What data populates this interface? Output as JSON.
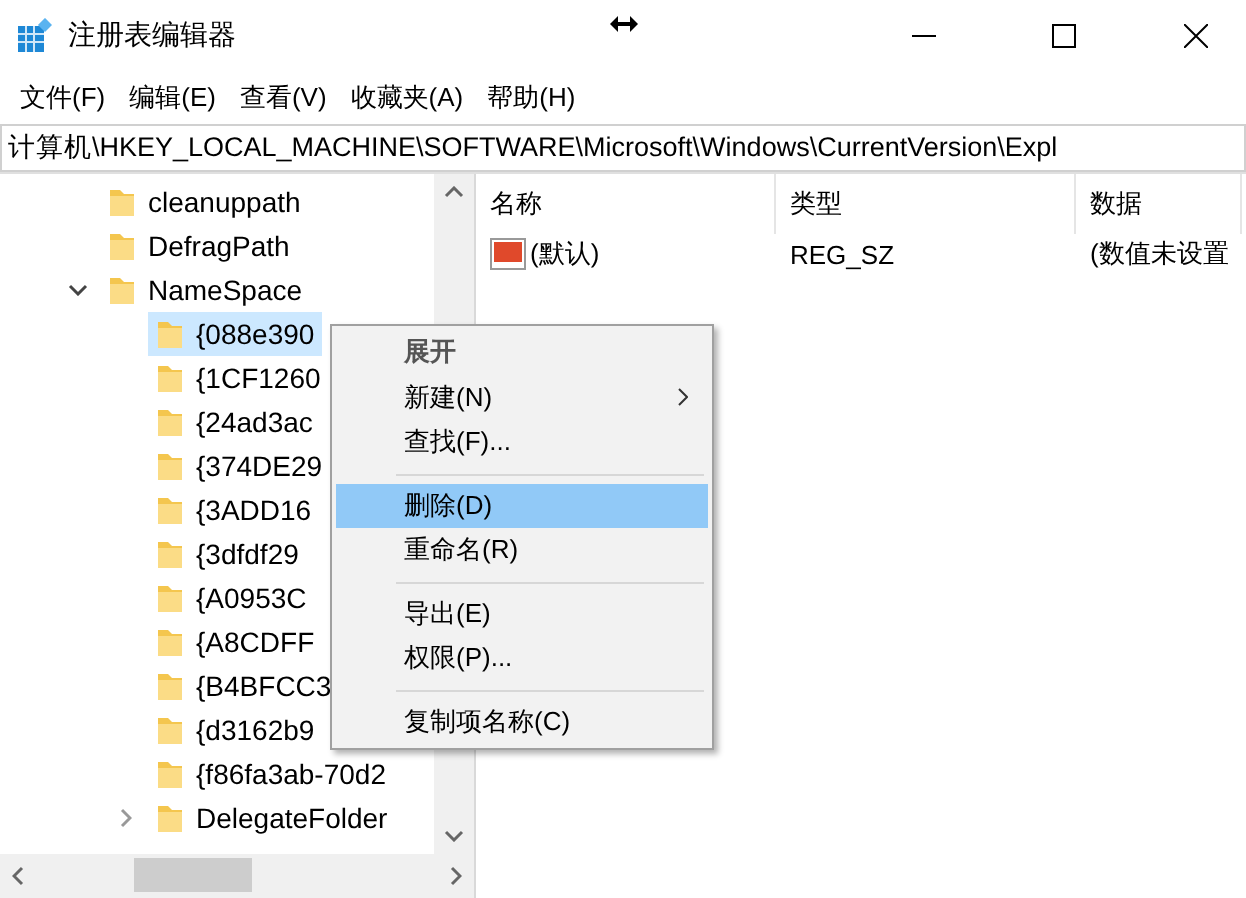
{
  "window": {
    "title": "注册表编辑器"
  },
  "menu_bar": [
    "文件(F)",
    "编辑(E)",
    "查看(V)",
    "收藏夹(A)",
    "帮助(H)"
  ],
  "address_bar": {
    "value": "计算机\\HKEY_LOCAL_MACHINE\\SOFTWARE\\Microsoft\\Windows\\CurrentVersion\\Expl"
  },
  "tree": [
    {
      "label": "cleanuppath",
      "selected": false
    },
    {
      "label": "DefragPath",
      "selected": false
    },
    {
      "label": "NameSpace",
      "selected": false,
      "expanded": true,
      "children": [
        {
          "label": "{088e390",
          "selected": true
        },
        {
          "label": "{1CF1260",
          "selected": false
        },
        {
          "label": "{24ad3ac",
          "selected": false
        },
        {
          "label": "{374DE29",
          "selected": false
        },
        {
          "label": "{3ADD16",
          "selected": false
        },
        {
          "label": "{3dfdf29",
          "selected": false
        },
        {
          "label": "{A0953C",
          "selected": false
        },
        {
          "label": "{A8CDFF",
          "selected": false
        },
        {
          "label": "{B4BFCC3",
          "selected": false
        },
        {
          "label": "{d3162b9",
          "selected": false
        },
        {
          "label": "{f86fa3ab-70d2",
          "selected": false
        },
        {
          "label": "DelegateFolder",
          "selected": false,
          "expanded": false
        }
      ]
    }
  ],
  "values_table": {
    "columns": [
      "名称",
      "类型",
      "数据"
    ],
    "rows": [
      {
        "name": "(默认)",
        "type": "REG_SZ",
        "data": "(数值未设置"
      }
    ]
  },
  "context_menu": [
    {
      "kind": "item",
      "label": "展开",
      "default": true,
      "selected": false
    },
    {
      "kind": "item",
      "label": "新建(N)",
      "submenu": true,
      "selected": false
    },
    {
      "kind": "item",
      "label": "查找(F)...",
      "selected": false
    },
    {
      "kind": "separator"
    },
    {
      "kind": "item",
      "label": "删除(D)",
      "selected": true
    },
    {
      "kind": "item",
      "label": "重命名(R)",
      "selected": false
    },
    {
      "kind": "separator"
    },
    {
      "kind": "item",
      "label": "导出(E)",
      "selected": false
    },
    {
      "kind": "item",
      "label": "权限(P)...",
      "selected": false
    },
    {
      "kind": "separator"
    },
    {
      "kind": "item",
      "label": "复制项名称(C)",
      "selected": false
    }
  ]
}
